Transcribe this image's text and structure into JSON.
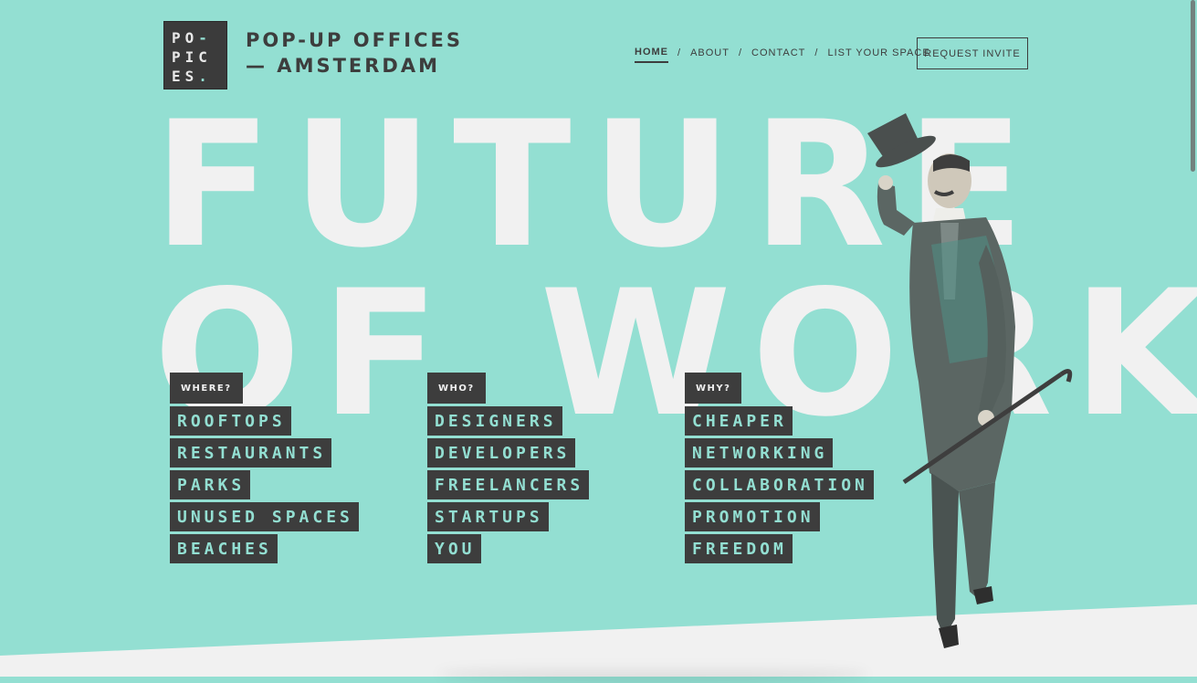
{
  "logo": {
    "lines": [
      [
        "PO",
        "-"
      ],
      [
        "PIC",
        ""
      ],
      [
        "ES",
        "."
      ]
    ]
  },
  "brand": {
    "line1": "POP-UP OFFICES",
    "line2": "— AMSTERDAM"
  },
  "nav": {
    "items": [
      {
        "label": "HOME",
        "active": true
      },
      {
        "label": "ABOUT",
        "active": false
      },
      {
        "label": "CONTACT",
        "active": false
      },
      {
        "label": "LIST YOUR SPACE",
        "active": false
      }
    ],
    "separator": "/"
  },
  "invite_button": {
    "label": "REQUEST INVITE"
  },
  "headline": {
    "line1": "FUTURE",
    "line2": "OF WORK"
  },
  "columns": [
    {
      "label": "WHERE?",
      "tags": [
        "ROOFTOPS",
        "RESTAURANTS",
        "PARKS",
        "UNUSED SPACES",
        "BEACHES"
      ]
    },
    {
      "label": "WHO?",
      "tags": [
        "DESIGNERS",
        "DEVELOPERS",
        "FREELANCERS",
        "STARTUPS",
        "YOU"
      ]
    },
    {
      "label": "WHY?",
      "tags": [
        "CHEAPER",
        "NETWORKING",
        "COLLABORATION",
        "PROMOTION",
        "FREEDOM"
      ]
    }
  ],
  "colors": {
    "background": "#93dfd2",
    "dark": "#3d3d3d",
    "light": "#f1f1f1",
    "accent": "#93dfd2"
  },
  "illustration": {
    "icon": "gentleman-with-top-hat-and-cane-illustration"
  }
}
